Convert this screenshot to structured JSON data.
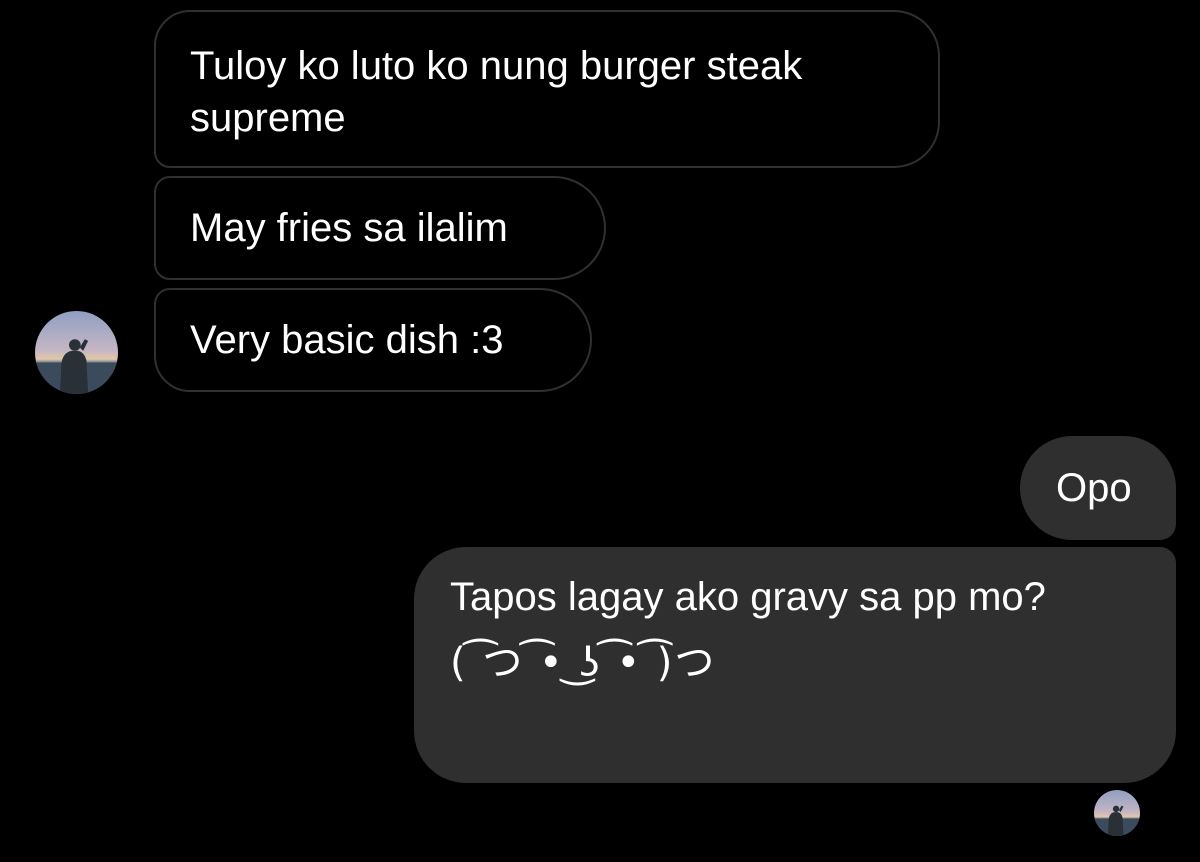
{
  "conversation": {
    "received_messages": [
      {
        "text_line1": "Tuloy ko luto ko nung burger steak",
        "text_line2": "supreme"
      },
      {
        "text": "May fries sa ilalim"
      },
      {
        "text": "Very basic dish :3"
      }
    ],
    "sent_messages": [
      {
        "text": "Opo"
      },
      {
        "text": "Tapos lagay ako gravy sa pp mo?",
        "kaomoji": "( ͡つ ͡• ͜ʖ ͡• ͡)つ"
      }
    ]
  },
  "colors": {
    "background": "#000000",
    "sent_bubble": "#2f2f2f",
    "received_border": "#303030",
    "text": "#ffffff"
  },
  "icons": {
    "contact_avatar": "avatar-photo-person-at-beach",
    "read_receipt_avatar": "avatar-photo-person-at-beach"
  }
}
